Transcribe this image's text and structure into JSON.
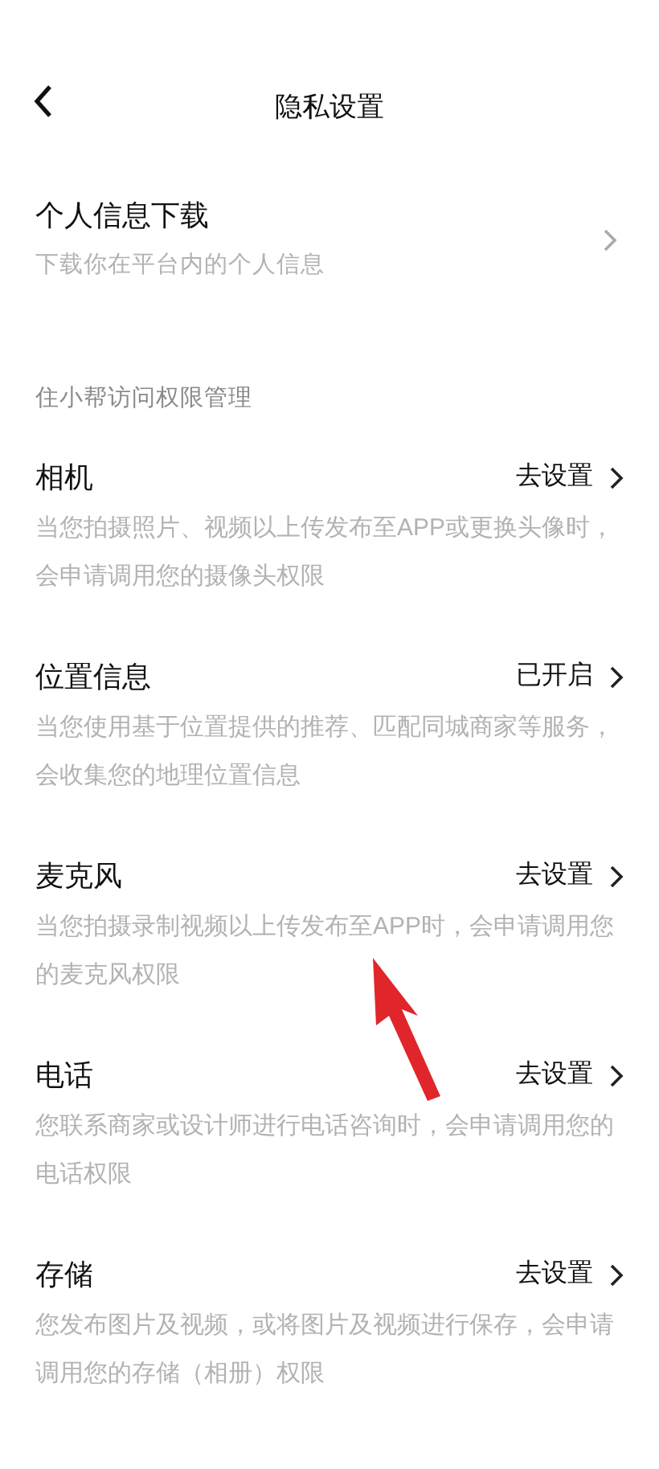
{
  "header": {
    "title": "隐私设置"
  },
  "download": {
    "title": "个人信息下载",
    "description": "下载你在平台内的个人信息"
  },
  "section": {
    "title": "住小帮访问权限管理"
  },
  "permissions": [
    {
      "name": "相机",
      "status": "去设置",
      "description": "当您拍摄照片、视频以上传发布至APP或更换头像时，会申请调用您的摄像头权限"
    },
    {
      "name": "位置信息",
      "status": "已开启",
      "description": "当您使用基于位置提供的推荐、匹配同城商家等服务，会收集您的地理位置信息"
    },
    {
      "name": "麦克风",
      "status": "去设置",
      "description": "当您拍摄录制视频以上传发布至APP时，会申请调用您的麦克风权限"
    },
    {
      "name": "电话",
      "status": "去设置",
      "description": "您联系商家或设计师进行电话咨询时，会申请调用您的电话权限"
    },
    {
      "name": "存储",
      "status": "去设置",
      "description": "您发布图片及视频，或将图片及视频进行保存，会申请调用您的存储（相册）权限"
    }
  ]
}
